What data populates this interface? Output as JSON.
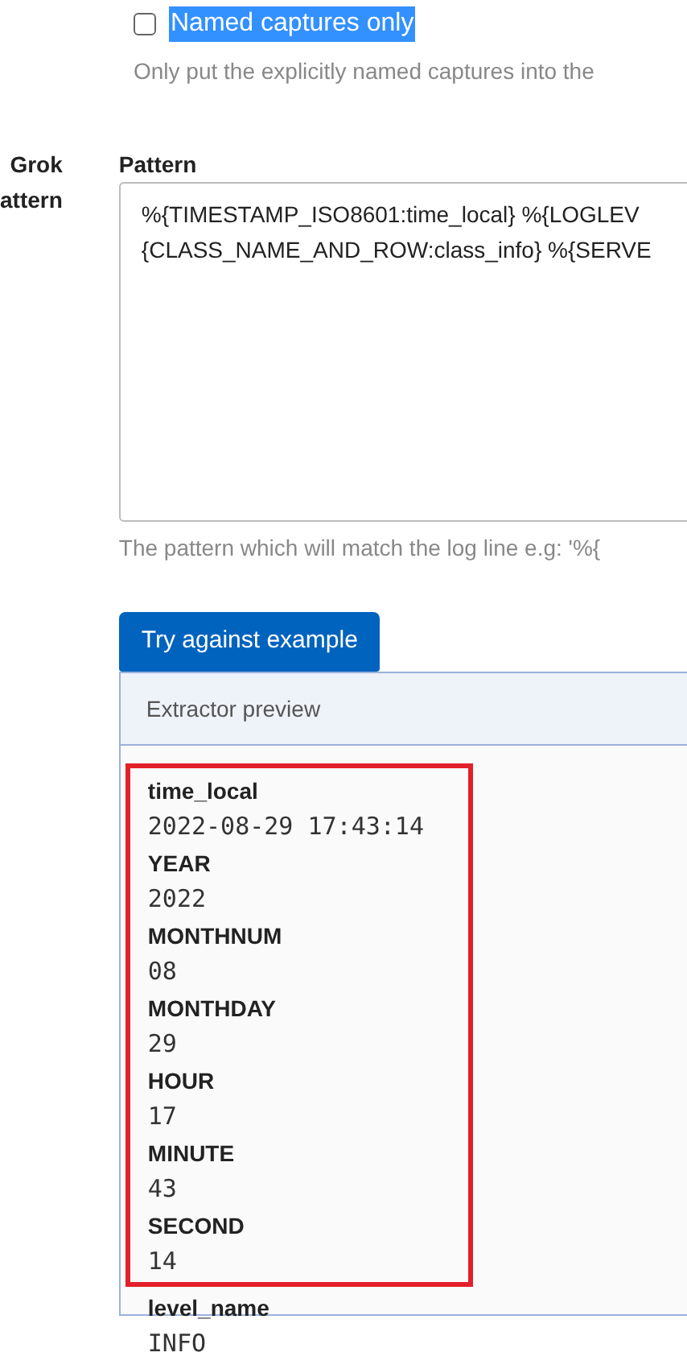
{
  "named_captures": {
    "label": "Named captures only",
    "checked": false,
    "selected": true,
    "help": "Only put the explicitly named captures into the"
  },
  "grok_pattern": {
    "label_lines": [
      "Grok",
      "attern"
    ],
    "field_label": "Pattern",
    "value_lines": [
      "%{TIMESTAMP_ISO8601:time_local} %{LOGLEV",
      "{CLASS_NAME_AND_ROW:class_info} %{SERVE"
    ],
    "help": "The pattern which will match the log line e.g: '%{"
  },
  "try_button": "Try against example",
  "preview": {
    "title": "Extractor preview",
    "framed_fields": [
      {
        "name": "time_local",
        "value": "2022-08-29 17:43:14"
      },
      {
        "name": "YEAR",
        "value": "2022"
      },
      {
        "name": "MONTHNUM",
        "value": "08"
      },
      {
        "name": "MONTHDAY",
        "value": "29"
      },
      {
        "name": "HOUR",
        "value": "17"
      },
      {
        "name": "MINUTE",
        "value": "43"
      },
      {
        "name": "SECOND",
        "value": "14"
      }
    ],
    "fields": [
      {
        "name": "level_name",
        "value": "INFO"
      }
    ]
  }
}
